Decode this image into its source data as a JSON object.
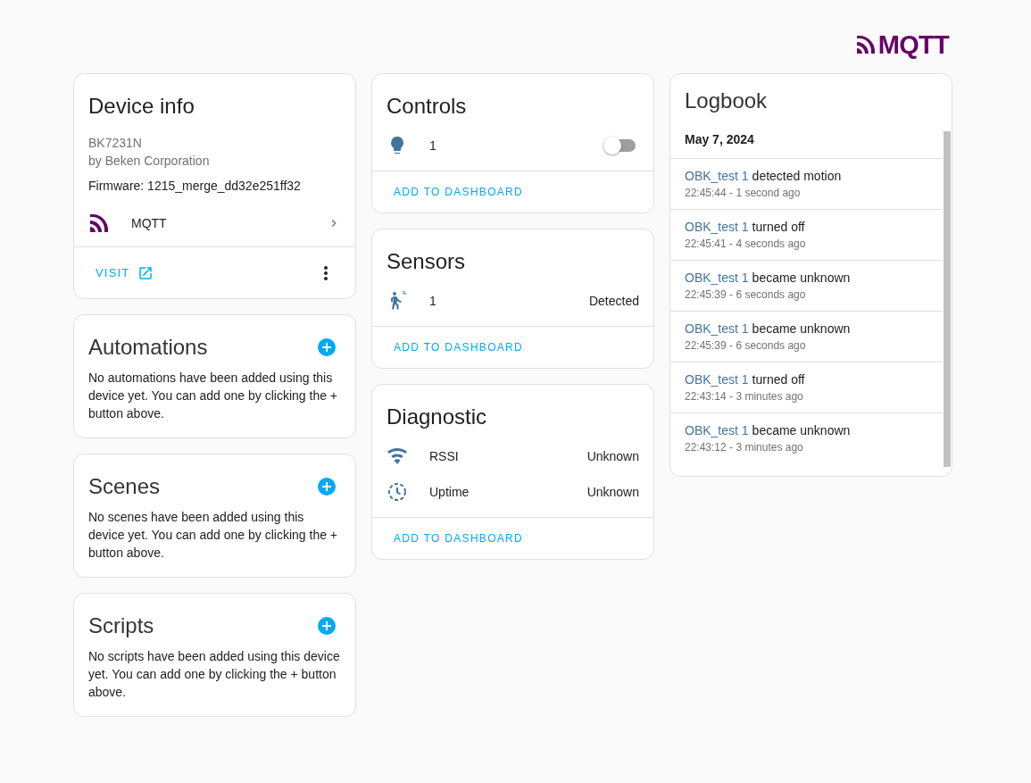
{
  "logo": {
    "text": "MQTT"
  },
  "device_info": {
    "title": "Device info",
    "model": "BK7231N",
    "manufacturer": "by Beken Corporation",
    "firmware": "Firmware: 1215_merge_dd32e251ff32",
    "integration": "MQTT",
    "visit": "VISIT"
  },
  "empty_cards": [
    {
      "title": "Automations",
      "text": "No automations have been added using this device yet. You can add one by clicking the + button above."
    },
    {
      "title": "Scenes",
      "text": "No scenes have been added using this device yet. You can add one by clicking the + button above."
    },
    {
      "title": "Scripts",
      "text": "No scripts have been added using this device yet. You can add one by clicking the + button above."
    }
  ],
  "entity_cards": [
    {
      "title": "Controls",
      "action": "ADD TO DASHBOARD",
      "entities": [
        {
          "kind": "light",
          "name": "1",
          "on": false
        }
      ]
    },
    {
      "title": "Sensors",
      "action": "ADD TO DASHBOARD",
      "entities": [
        {
          "kind": "motion",
          "name": "1",
          "state": "Detected"
        }
      ]
    },
    {
      "title": "Diagnostic",
      "action": "ADD TO DASHBOARD",
      "entities": [
        {
          "kind": "signal",
          "name": "RSSI",
          "state": "Unknown"
        },
        {
          "kind": "uptime",
          "name": "Uptime",
          "state": "Unknown"
        }
      ]
    }
  ],
  "logbook": {
    "title": "Logbook",
    "date": "May 7, 2024",
    "entries": [
      {
        "entity": "OBK_test 1",
        "message": "detected motion",
        "time": "22:45:44 - 1 second ago"
      },
      {
        "entity": "OBK_test 1",
        "message": "turned off",
        "time": "22:45:41 - 4 seconds ago"
      },
      {
        "entity": "OBK_test 1",
        "message": "became unknown",
        "time": "22:45:39 - 6 seconds ago"
      },
      {
        "entity": "OBK_test 1",
        "message": "became unknown",
        "time": "22:45:39 - 6 seconds ago"
      },
      {
        "entity": "OBK_test 1",
        "message": "turned off",
        "time": "22:43:14 - 3 minutes ago"
      },
      {
        "entity": "OBK_test 1",
        "message": "became unknown",
        "time": "22:43:12 - 3 minutes ago"
      }
    ]
  }
}
